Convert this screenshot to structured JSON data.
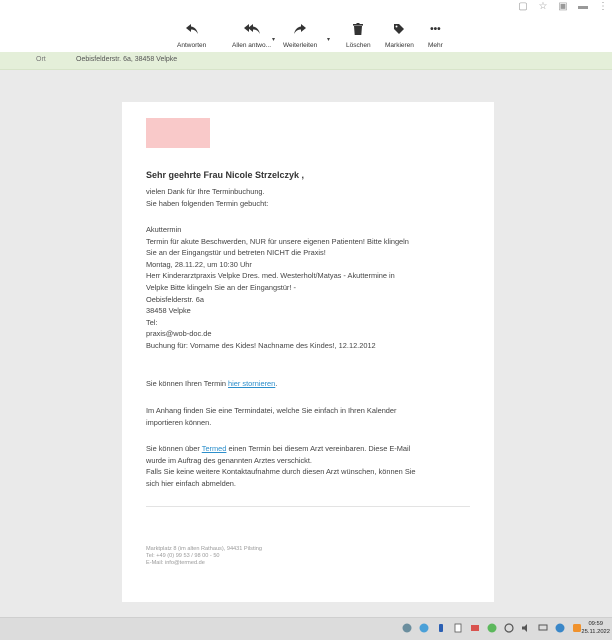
{
  "toolbar": {
    "reply": "Antworten",
    "reply_all": "Allen antwo...",
    "forward": "Weiterleiten",
    "delete": "Löschen",
    "mark": "Markieren",
    "more": "Mehr",
    "dropdown": "▾"
  },
  "info": {
    "label": "Ort",
    "value": "Oebisfelderstr. 6a, 38458 Velpke"
  },
  "email": {
    "greeting": "Sehr geehrte Frau Nicole Strzelczyk ,",
    "intro": [
      "vielen Dank für Ihre Terminbuchung.",
      "Sie haben folgenden Termin gebucht:"
    ],
    "details": [
      "Akuttermin",
      "Termin für akute Beschwerden, NUR für unsere eigenen Patienten! Bitte klingeln",
      "Sie an der Eingangstür und betreten NICHT die Praxis!",
      "Montag, 28.11.22, um 10:30 Uhr",
      "Herr Kinderarztpraxis Velpke Dres. med. Westerholt/Matyas - Akuttermine in",
      "Velpke Bitte klingeln Sie an der Eingangstür! -",
      "Oebisfelderstr. 6a",
      "38458 Velpke",
      "Tel:",
      "praxis@wob-doc.de",
      "Buchung für: Vorname des Kides! Nachname des Kindes!, 12.12.2012"
    ],
    "cancel_prefix": "Sie können Ihren Termin ",
    "cancel_link": "hier stornieren",
    "cancel_suffix": ".",
    "attachment": [
      "Im Anhang finden Sie eine Termindatei, welche Sie einfach in Ihren Kalender",
      "importieren können."
    ],
    "termed_prefix": "Sie können über ",
    "termed_link": "Termed",
    "termed_suffix": " einen Termin bei diesem Arzt vereinbaren. Diese E-Mail",
    "termed_rest": [
      "wurde im Auftrag des genannten Arztes verschickt.",
      "Falls Sie keine weitere Kontaktaufnahme durch diesen Arzt wünschen, können Sie",
      "sich hier einfach abmelden."
    ],
    "footer": [
      "Marktplatz 8 (im alten Rathaus), 94431 Pilsting",
      "Tel: +49 (0) 99 53 / 98 00 - 50",
      "E-Mail: info@termed.de"
    ]
  },
  "clock": {
    "time": "09:59",
    "date": "25.11.2022"
  },
  "colors": {
    "link": "#2b8ecb",
    "info_strip": "#e4efd9",
    "logo_placeholder": "#f9c9c9"
  }
}
